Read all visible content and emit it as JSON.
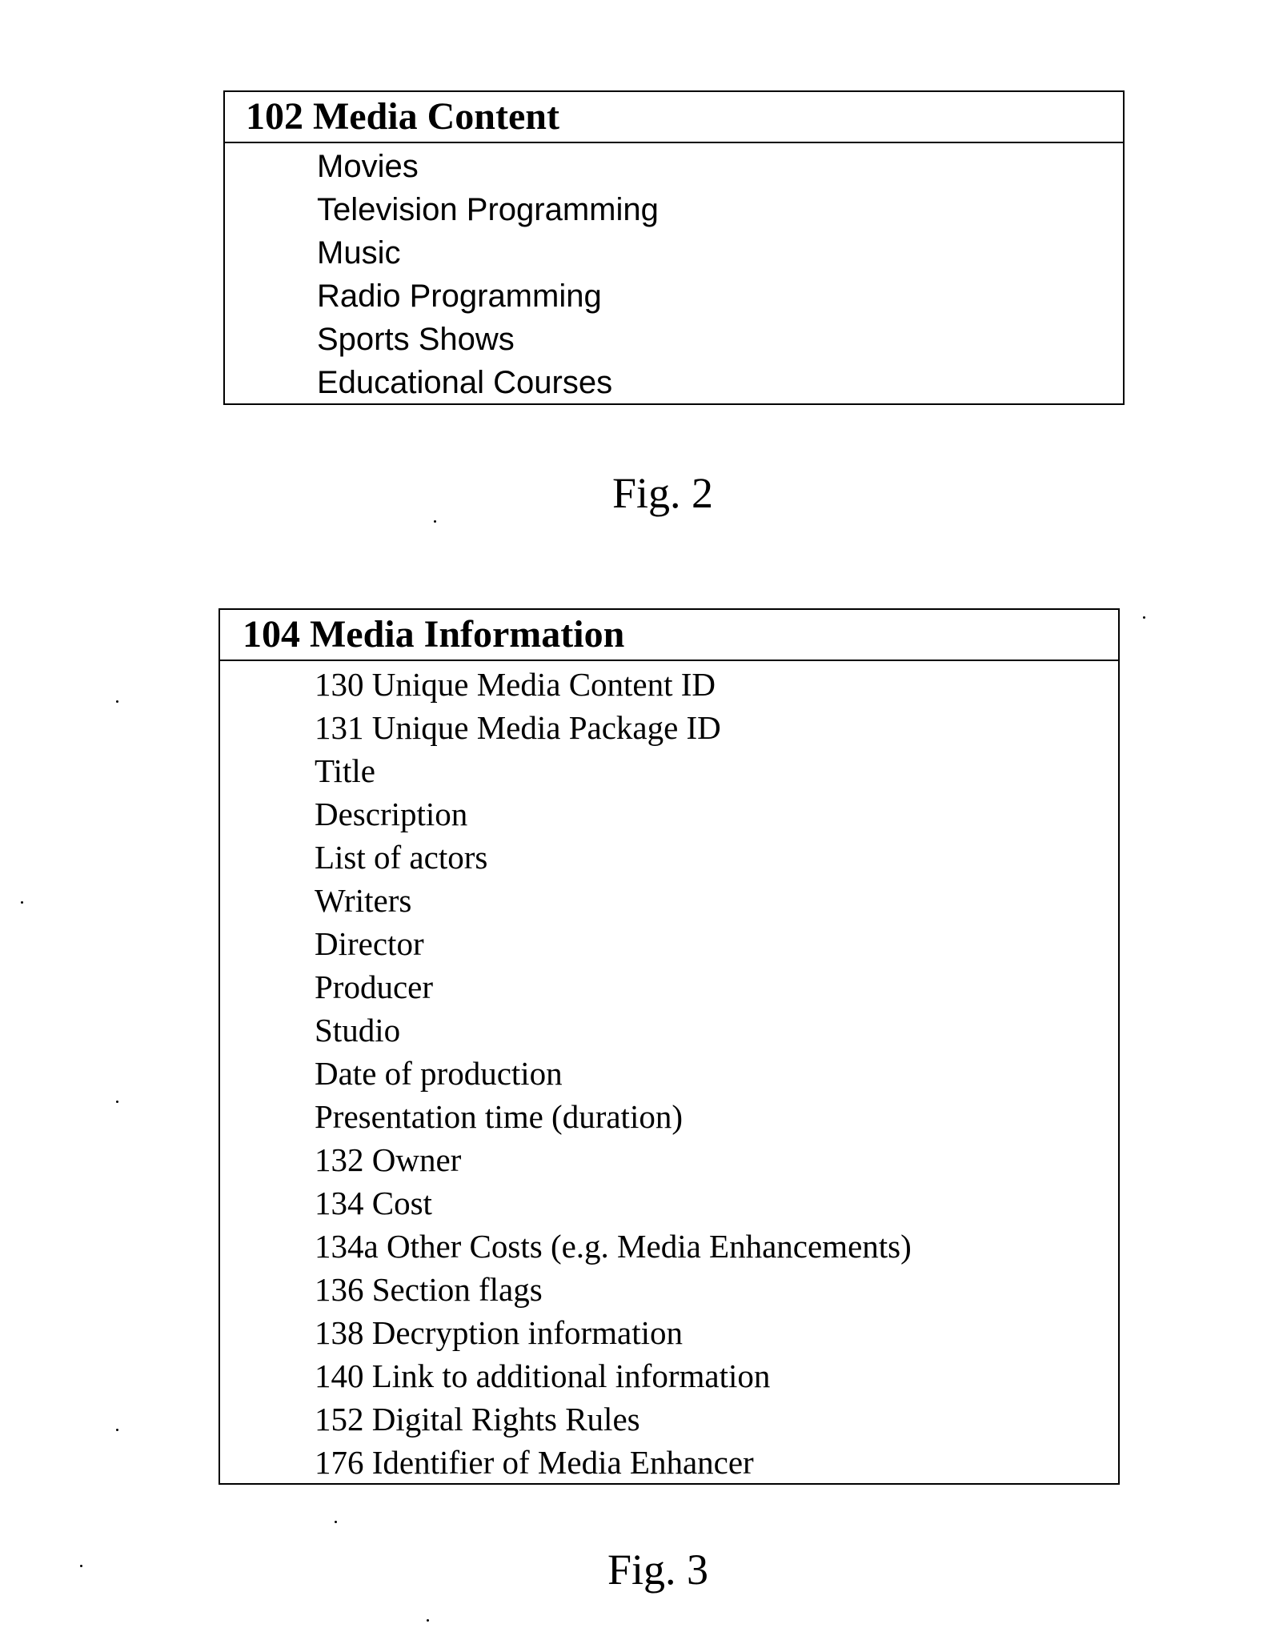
{
  "figures": [
    {
      "caption": "Fig. 2",
      "table": {
        "header": "102 Media Content",
        "items": [
          "Movies",
          "Television Programming",
          "Music",
          "Radio Programming",
          "Sports Shows",
          "Educational Courses"
        ]
      }
    },
    {
      "caption": "Fig. 3",
      "table": {
        "header": "104 Media Information",
        "items": [
          "130 Unique Media Content ID",
          "131 Unique Media Package ID",
          "Title",
          "Description",
          "List of actors",
          "Writers",
          "Director",
          "Producer",
          "Studio",
          "Date of production",
          "Presentation time (duration)",
          "132 Owner",
          "134 Cost",
          "134a Other Costs (e.g. Media Enhancements)",
          "136 Section flags",
          "138 Decryption information",
          "140 Link to additional information",
          "152 Digital Rights Rules",
          "176 Identifier of Media Enhancer"
        ]
      }
    }
  ]
}
